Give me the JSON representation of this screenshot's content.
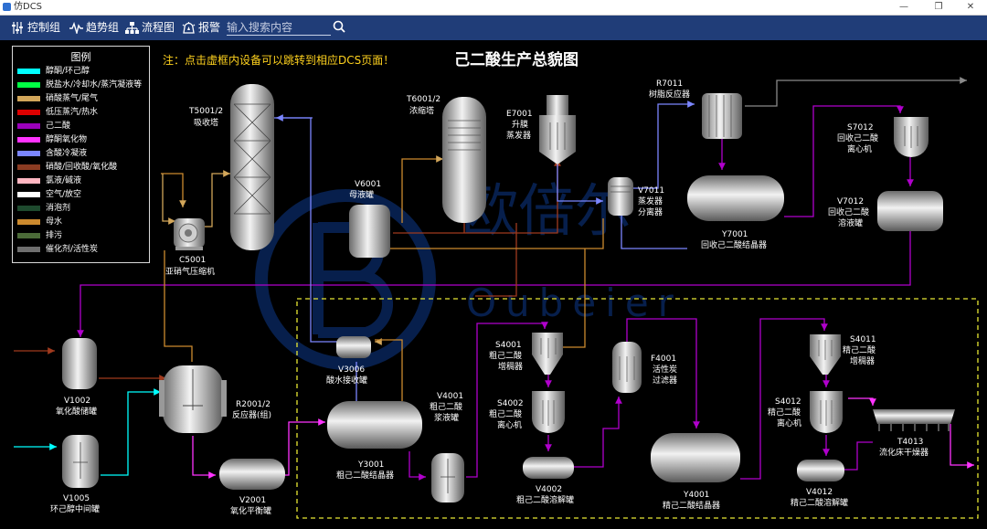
{
  "window": {
    "title": "仿DCS",
    "minimize": "—",
    "maximize": "❐",
    "close": "✕"
  },
  "toolbar": {
    "items": [
      {
        "label": "控制组",
        "icon": "control-group-icon"
      },
      {
        "label": "趋势组",
        "icon": "trend-icon"
      },
      {
        "label": "流程图",
        "icon": "flowchart-icon"
      },
      {
        "label": "报警",
        "icon": "alarm-icon"
      }
    ],
    "search_placeholder": "输入搜索内容"
  },
  "legend": {
    "title": "图例",
    "items": [
      {
        "label": "醇酮/环己醇",
        "color": "#00ffff"
      },
      {
        "label": "脱盐水/冷却水/蒸汽凝液等",
        "color": "#00ff44"
      },
      {
        "label": "硝酸蒸气/尾气",
        "color": "#d2a65a"
      },
      {
        "label": "低压蒸汽/热水",
        "color": "#dd0000"
      },
      {
        "label": "己二酸",
        "color": "#9b00bb"
      },
      {
        "label": "醇酮氧化物",
        "color": "#ff33ff"
      },
      {
        "label": "含酸冷凝液",
        "color": "#7b86ff"
      },
      {
        "label": "硝酸/回收酸/氧化酸",
        "color": "#8b3c22"
      },
      {
        "label": "氯液/碱液",
        "color": "#ffb6c1"
      },
      {
        "label": "空气/放空",
        "color": "#ffffff"
      },
      {
        "label": "消泡剂",
        "color": "#1e4a2e"
      },
      {
        "label": "母水",
        "color": "#cc8a2e"
      },
      {
        "label": "排污",
        "color": "#4b6b38"
      },
      {
        "label": "催化剂/活性炭",
        "color": "#6e6e6e"
      }
    ]
  },
  "notice": "注：点击虚框内设备可以跳转到相应DCS页面！",
  "page_title": "己二酸生产总貌图",
  "watermark": {
    "text": "欧倍尔",
    "sub": "Oubeier"
  },
  "equipment": {
    "t5001": {
      "tag": "T5001/2",
      "name": "吸收塔"
    },
    "t6001": {
      "tag": "T6001/2",
      "name": "浓缩塔"
    },
    "e7001": {
      "tag": "E7001",
      "name1": "升膜",
      "name2": "蒸发器"
    },
    "r7011": {
      "tag": "R7011",
      "name": "树脂反应器"
    },
    "s7012": {
      "tag": "S7012",
      "name1": "回收己二酸",
      "name2": "离心机"
    },
    "v7011": {
      "tag": "V7011",
      "name1": "蒸发器",
      "name2": "分离器"
    },
    "v6001": {
      "tag": "V6001",
      "name": "母液罐"
    },
    "y7001": {
      "tag": "Y7001",
      "name": "回收己二酸结晶器"
    },
    "v7012": {
      "tag": "V7012",
      "name1": "回收己二酸",
      "name2": "溶液罐"
    },
    "c5001": {
      "tag": "C5001",
      "name": "亚硝气压缩机"
    },
    "v1002": {
      "tag": "V1002",
      "name": "氧化酸储罐"
    },
    "v1005": {
      "tag": "V1005",
      "name": "环己醇中间罐"
    },
    "r2001": {
      "tag": "R2001/2",
      "name": "反应器(组)"
    },
    "v2001": {
      "tag": "V2001",
      "name": "氧化平衡罐"
    },
    "v3006": {
      "tag": "V3006",
      "name": "酸水接收罐"
    },
    "y3001": {
      "tag": "Y3001",
      "name": "粗己二酸结晶器"
    },
    "v4001": {
      "tag": "V4001",
      "name1": "粗己二酸",
      "name2": "浆液罐"
    },
    "s4001": {
      "tag": "S4001",
      "name1": "粗己二酸",
      "name2": "增稠器"
    },
    "s4002": {
      "tag": "S4002",
      "name1": "粗己二酸",
      "name2": "离心机"
    },
    "v4002": {
      "tag": "V4002",
      "name": "粗己二酸溶解罐"
    },
    "f4001": {
      "tag": "F4001",
      "name1": "活性炭",
      "name2": "过滤器"
    },
    "y4001": {
      "tag": "Y4001",
      "name": "精己二酸结晶器"
    },
    "s4011": {
      "tag": "S4011",
      "name1": "精己二酸",
      "name2": "增稠器"
    },
    "s4012": {
      "tag": "S4012",
      "name1": "精己二酸",
      "name2": "离心机"
    },
    "v4012": {
      "tag": "V4012",
      "name": "精己二酸溶解罐"
    },
    "t4013": {
      "tag": "T4013",
      "name": "流化床干燥器"
    }
  }
}
